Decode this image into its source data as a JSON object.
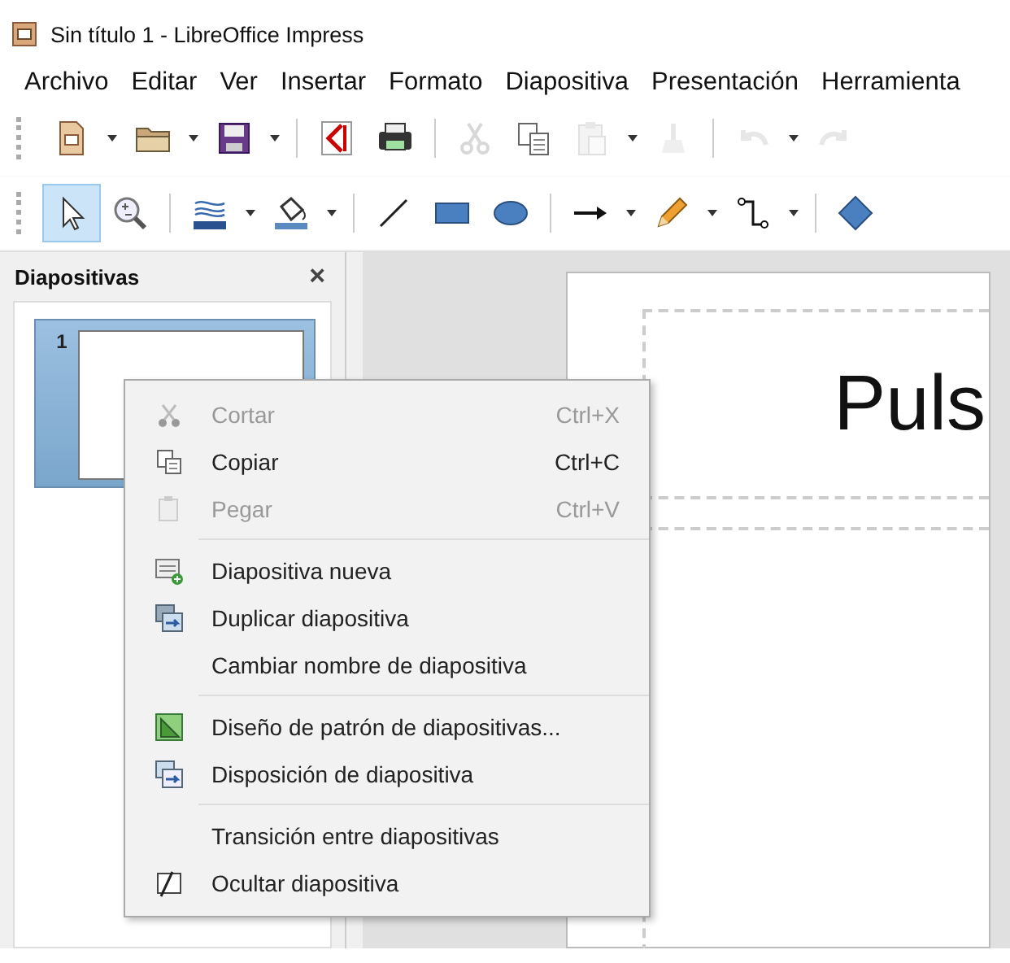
{
  "window": {
    "title": "Sin título 1 - LibreOffice Impress"
  },
  "menu_bar": [
    {
      "label": "Archivo"
    },
    {
      "label": "Editar"
    },
    {
      "label": "Ver"
    },
    {
      "label": "Insertar"
    },
    {
      "label": "Formato"
    },
    {
      "label": "Diapositiva"
    },
    {
      "label": "Presentación"
    },
    {
      "label": "Herramienta"
    }
  ],
  "toolbars": [
    [
      {
        "kind": "new",
        "dropdown": true,
        "disabled": false
      },
      {
        "kind": "open",
        "dropdown": true,
        "disabled": false
      },
      {
        "kind": "save",
        "dropdown": true,
        "disabled": false
      },
      {
        "kind": "separator"
      },
      {
        "kind": "pdf",
        "dropdown": false,
        "disabled": false
      },
      {
        "kind": "print",
        "dropdown": false,
        "disabled": false
      },
      {
        "kind": "separator"
      },
      {
        "kind": "cut",
        "dropdown": false,
        "disabled": true
      },
      {
        "kind": "copy",
        "dropdown": false,
        "disabled": false
      },
      {
        "kind": "paste",
        "dropdown": true,
        "disabled": true
      },
      {
        "kind": "brush",
        "dropdown": false,
        "disabled": true
      },
      {
        "kind": "separator"
      },
      {
        "kind": "undo",
        "dropdown": true,
        "disabled": true
      },
      {
        "kind": "redo",
        "dropdown": false,
        "disabled": true
      }
    ],
    [
      {
        "kind": "select",
        "dropdown": false,
        "selected": true
      },
      {
        "kind": "zoom",
        "dropdown": false,
        "selected": false
      },
      {
        "kind": "separator"
      },
      {
        "kind": "linecolor",
        "dropdown": true,
        "selected": false
      },
      {
        "kind": "fill",
        "dropdown": true,
        "selected": false
      },
      {
        "kind": "separator"
      },
      {
        "kind": "line",
        "dropdown": false,
        "selected": false
      },
      {
        "kind": "rect",
        "dropdown": false,
        "selected": false
      },
      {
        "kind": "ellipse",
        "dropdown": false,
        "selected": false
      },
      {
        "kind": "separator"
      },
      {
        "kind": "arrow",
        "dropdown": true,
        "selected": false
      },
      {
        "kind": "pencil",
        "dropdown": true,
        "selected": false
      },
      {
        "kind": "connector",
        "dropdown": true,
        "selected": false
      },
      {
        "kind": "separator"
      },
      {
        "kind": "diamond",
        "dropdown": false,
        "selected": false
      }
    ]
  ],
  "slides_panel": {
    "title": "Diapositivas",
    "close": "×",
    "slides": [
      {
        "number": "1",
        "selected": true
      }
    ]
  },
  "slide": {
    "title_placeholder": "Puls"
  },
  "context_menu": {
    "groups": [
      [
        {
          "label": "Cortar",
          "shortcut": "Ctrl+X",
          "kind": "cut",
          "disabled": true
        },
        {
          "label": "Copiar",
          "shortcut": "Ctrl+C",
          "kind": "copy",
          "disabled": false
        },
        {
          "label": "Pegar",
          "shortcut": "Ctrl+V",
          "kind": "paste",
          "disabled": true
        }
      ],
      [
        {
          "label": "Diapositiva nueva",
          "kind": "new-slide",
          "disabled": false
        },
        {
          "label": "Duplicar diapositiva",
          "kind": "duplicate",
          "disabled": false
        },
        {
          "label": "Cambiar nombre de diapositiva",
          "kind": "plain",
          "disabled": false
        }
      ],
      [
        {
          "label": "Diseño de patrón de diapositivas...",
          "kind": "master",
          "disabled": false
        },
        {
          "label": "Disposición de diapositiva",
          "kind": "layout",
          "disabled": false
        }
      ],
      [
        {
          "label": "Transición entre diapositivas",
          "kind": "plain",
          "disabled": false
        },
        {
          "label": "Ocultar diapositiva",
          "kind": "hide",
          "disabled": false
        }
      ]
    ]
  }
}
